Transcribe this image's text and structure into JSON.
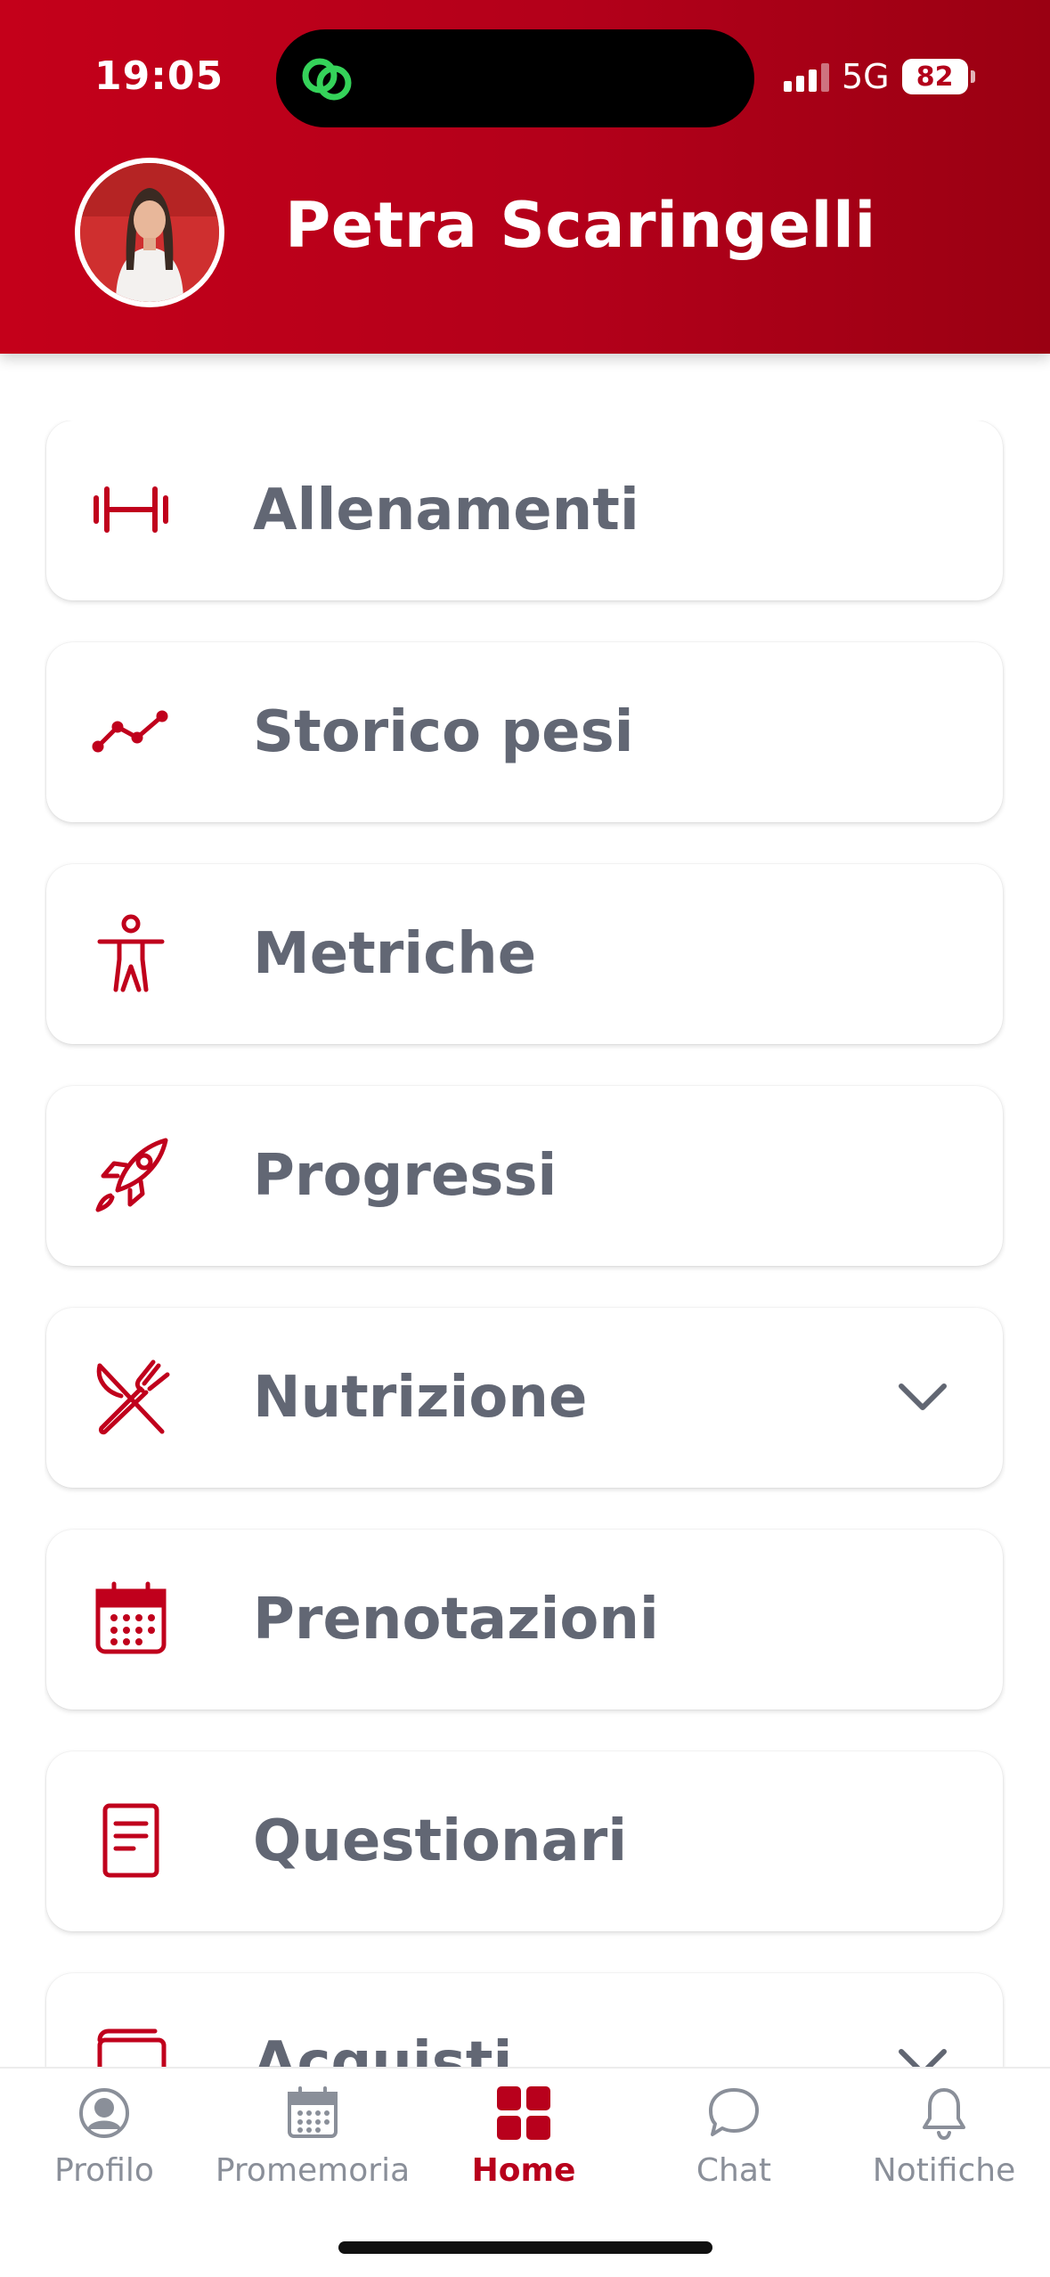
{
  "status_bar": {
    "time": "19:05",
    "network": "5G",
    "battery": "82"
  },
  "header": {
    "user_name": "Petra Scaringelli",
    "accent_color": "#b8001c"
  },
  "menu": {
    "items": [
      {
        "label": "Allenamenti",
        "icon": "dumbbell-icon"
      },
      {
        "label": "Storico pesi",
        "icon": "line-chart-icon"
      },
      {
        "label": "Metriche",
        "icon": "body-icon"
      },
      {
        "label": "Progressi",
        "icon": "rocket-icon"
      },
      {
        "label": "Nutrizione",
        "icon": "utensils-icon",
        "expandable": true
      },
      {
        "label": "Prenotazioni",
        "icon": "calendar-icon"
      },
      {
        "label": "Questionari",
        "icon": "document-icon"
      },
      {
        "label": "Acquisti",
        "icon": "wallet-icon",
        "expandable": true
      }
    ]
  },
  "bottom_nav": {
    "items": [
      {
        "label": "Profilo",
        "icon": "user-circle-icon"
      },
      {
        "label": "Promemoria",
        "icon": "calendar-icon"
      },
      {
        "label": "Home",
        "icon": "grid-icon",
        "active": true
      },
      {
        "label": "Chat",
        "icon": "chat-bubble-icon"
      },
      {
        "label": "Notifiche",
        "icon": "bell-icon"
      }
    ]
  }
}
